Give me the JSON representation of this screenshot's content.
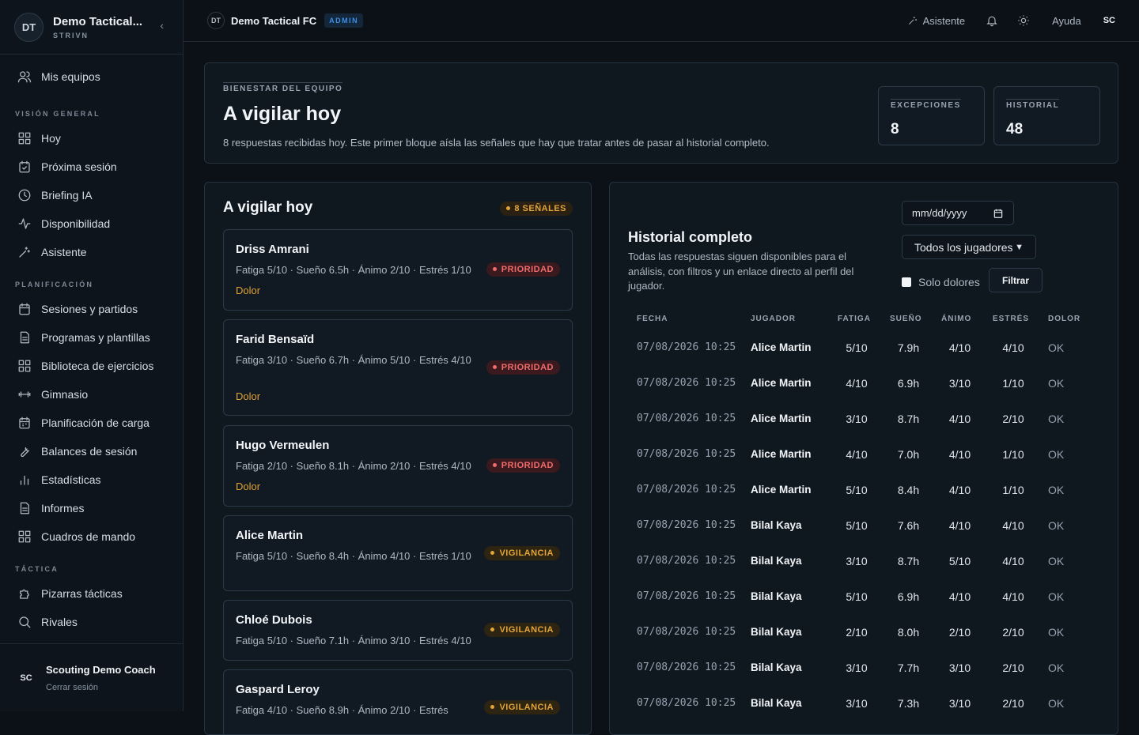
{
  "sidebar": {
    "team_initials": "DT",
    "team_name": "Demo Tactical...",
    "brand": "STRIVN",
    "top_item": "Mis equipos",
    "sections": [
      {
        "title": "VISIÓN GENERAL",
        "items": [
          "Hoy",
          "Próxima sesión",
          "Briefing IA",
          "Disponibilidad",
          "Asistente"
        ]
      },
      {
        "title": "PLANIFICACIÓN",
        "items": [
          "Sesiones y partidos",
          "Programas y plantillas",
          "Biblioteca de ejercicios",
          "Gimnasio",
          "Planificación de carga",
          "Balances de sesión",
          "Estadísticas",
          "Informes",
          "Cuadros de mando"
        ]
      },
      {
        "title": "TÁCTICA",
        "items": [
          "Pizarras tácticas",
          "Rivales"
        ]
      }
    ],
    "user_initials": "SC",
    "user_name": "Scouting Demo Coach",
    "logout": "Cerrar sesión"
  },
  "topbar": {
    "team_initials": "DT",
    "team_name": "Demo Tactical FC",
    "role_badge": "ADMIN",
    "assistant": "Asistente",
    "help": "Ayuda",
    "user_initials": "SC"
  },
  "hero": {
    "eyebrow": "BIENESTAR DEL EQUIPO",
    "title": "A vigilar hoy",
    "description": "8 respuestas recibidas hoy. Este primer bloque aísla las señales que hay que tratar antes de pasar al historial completo.",
    "stats": [
      {
        "label": "EXCEPCIONES",
        "value": "8"
      },
      {
        "label": "HISTORIAL",
        "value": "48"
      }
    ]
  },
  "watch": {
    "title": "A vigilar hoy",
    "badge": "8 SEÑALES",
    "players": [
      {
        "name": "Driss Amrani",
        "metrics": "Fatiga 5/10 · Sueño 6.5h · Ánimo 2/10 · Estrés 1/10",
        "flag": "Dolor",
        "level": "PRIORIDAD"
      },
      {
        "name": "Farid Bensaïd",
        "metrics": "Fatiga 3/10 · Sueño 6.7h · Ánimo 5/10 · Estrés 4/10",
        "flag": "Dolor",
        "level": "PRIORIDAD"
      },
      {
        "name": "Hugo Vermeulen",
        "metrics": "Fatiga 2/10 · Sueño 8.1h · Ánimo 2/10 · Estrés 4/10",
        "flag": "Dolor",
        "level": "PRIORIDAD"
      },
      {
        "name": "Alice Martin",
        "metrics": "Fatiga 5/10 · Sueño 8.4h · Ánimo 4/10 · Estrés 1/10",
        "flag": "",
        "level": "VIGILANCIA"
      },
      {
        "name": "Chloé Dubois",
        "metrics": "Fatiga 5/10 · Sueño 7.1h · Ánimo 3/10 · Estrés 4/10",
        "flag": "",
        "level": "VIGILANCIA"
      },
      {
        "name": "Gaspard Leroy",
        "metrics": "Fatiga 4/10 · Sueño 8.9h · Ánimo 2/10 · Estrés",
        "flag": "",
        "level": "VIGILANCIA"
      }
    ]
  },
  "history": {
    "title": "Historial completo",
    "description": "Todas las respuestas siguen disponibles para el análisis, con filtros y un enlace directo al perfil del jugador.",
    "date_placeholder": "mm/dd/yyyy",
    "player_filter": "Todos los jugadores",
    "pain_only": "Solo dolores",
    "filter_button": "Filtrar",
    "columns": [
      "FECHA",
      "JUGADOR",
      "FATIGA",
      "SUEÑO",
      "ÁNIMO",
      "ESTRÉS",
      "DOLOR"
    ],
    "rows": [
      [
        "07/08/2026 10:25",
        "Alice Martin",
        "5/10",
        "7.9h",
        "4/10",
        "4/10",
        "OK"
      ],
      [
        "07/08/2026 10:25",
        "Alice Martin",
        "4/10",
        "6.9h",
        "3/10",
        "1/10",
        "OK"
      ],
      [
        "07/08/2026 10:25",
        "Alice Martin",
        "3/10",
        "8.7h",
        "4/10",
        "2/10",
        "OK"
      ],
      [
        "07/08/2026 10:25",
        "Alice Martin",
        "4/10",
        "7.0h",
        "4/10",
        "1/10",
        "OK"
      ],
      [
        "07/08/2026 10:25",
        "Alice Martin",
        "5/10",
        "8.4h",
        "4/10",
        "1/10",
        "OK"
      ],
      [
        "07/08/2026 10:25",
        "Bilal Kaya",
        "5/10",
        "7.6h",
        "4/10",
        "4/10",
        "OK"
      ],
      [
        "07/08/2026 10:25",
        "Bilal Kaya",
        "3/10",
        "8.7h",
        "5/10",
        "4/10",
        "OK"
      ],
      [
        "07/08/2026 10:25",
        "Bilal Kaya",
        "5/10",
        "6.9h",
        "4/10",
        "4/10",
        "OK"
      ],
      [
        "07/08/2026 10:25",
        "Bilal Kaya",
        "2/10",
        "8.0h",
        "2/10",
        "2/10",
        "OK"
      ],
      [
        "07/08/2026 10:25",
        "Bilal Kaya",
        "3/10",
        "7.7h",
        "3/10",
        "2/10",
        "OK"
      ],
      [
        "07/08/2026 10:25",
        "Bilal Kaya",
        "3/10",
        "7.3h",
        "3/10",
        "2/10",
        "OK"
      ]
    ]
  }
}
